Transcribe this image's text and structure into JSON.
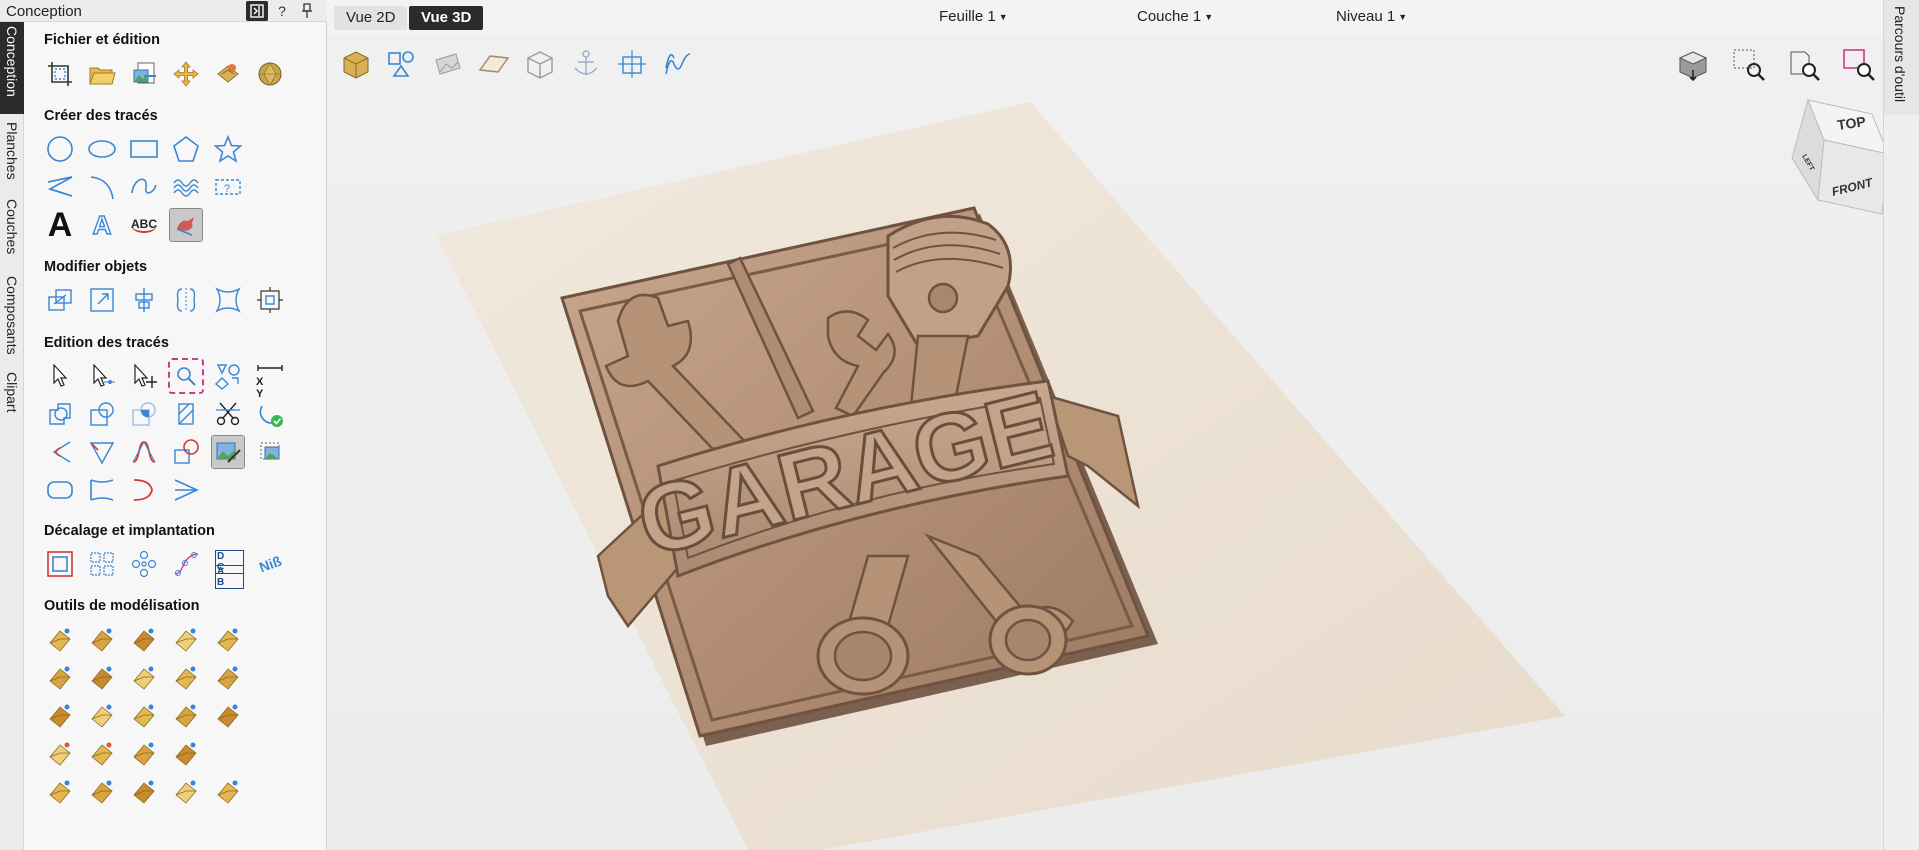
{
  "panel": {
    "title": "Conception",
    "help": "?",
    "pin": "📌"
  },
  "vtabs": [
    "Conception",
    "Planches",
    "Couches",
    "Composants",
    "Clipart"
  ],
  "sections": {
    "file": "Fichier et édition",
    "create": "Créer des tracés",
    "modify": "Modifier objets",
    "edit": "Edition des tracés",
    "offset": "Décalage et implantation",
    "modeling": "Outils de modélisation"
  },
  "create_text": {
    "big_a": "A",
    "outline_a": "A",
    "abc": "ABC",
    "xy": "X Y"
  },
  "offset_labels": {
    "dc": "D C",
    "ab": "A B",
    "nest": "Niß"
  },
  "top": {
    "tab_2d": "Vue 2D",
    "tab_3d": "Vue 3D",
    "sheet": "Feuille 1",
    "layer": "Couche 1",
    "level": "Niveau 1"
  },
  "right_tab": "Parcours d'outil",
  "scene": {
    "sign_text": "GARAGE"
  },
  "view_cube": {
    "top": "TOP",
    "front": "FRONT",
    "left": "LEFT"
  },
  "colors": {
    "accent": "#3a86d6",
    "dark_tab": "#2b2b2b",
    "relief": "#b89479",
    "relief_dark": "#7c5b44",
    "board": "#ece2d6"
  }
}
